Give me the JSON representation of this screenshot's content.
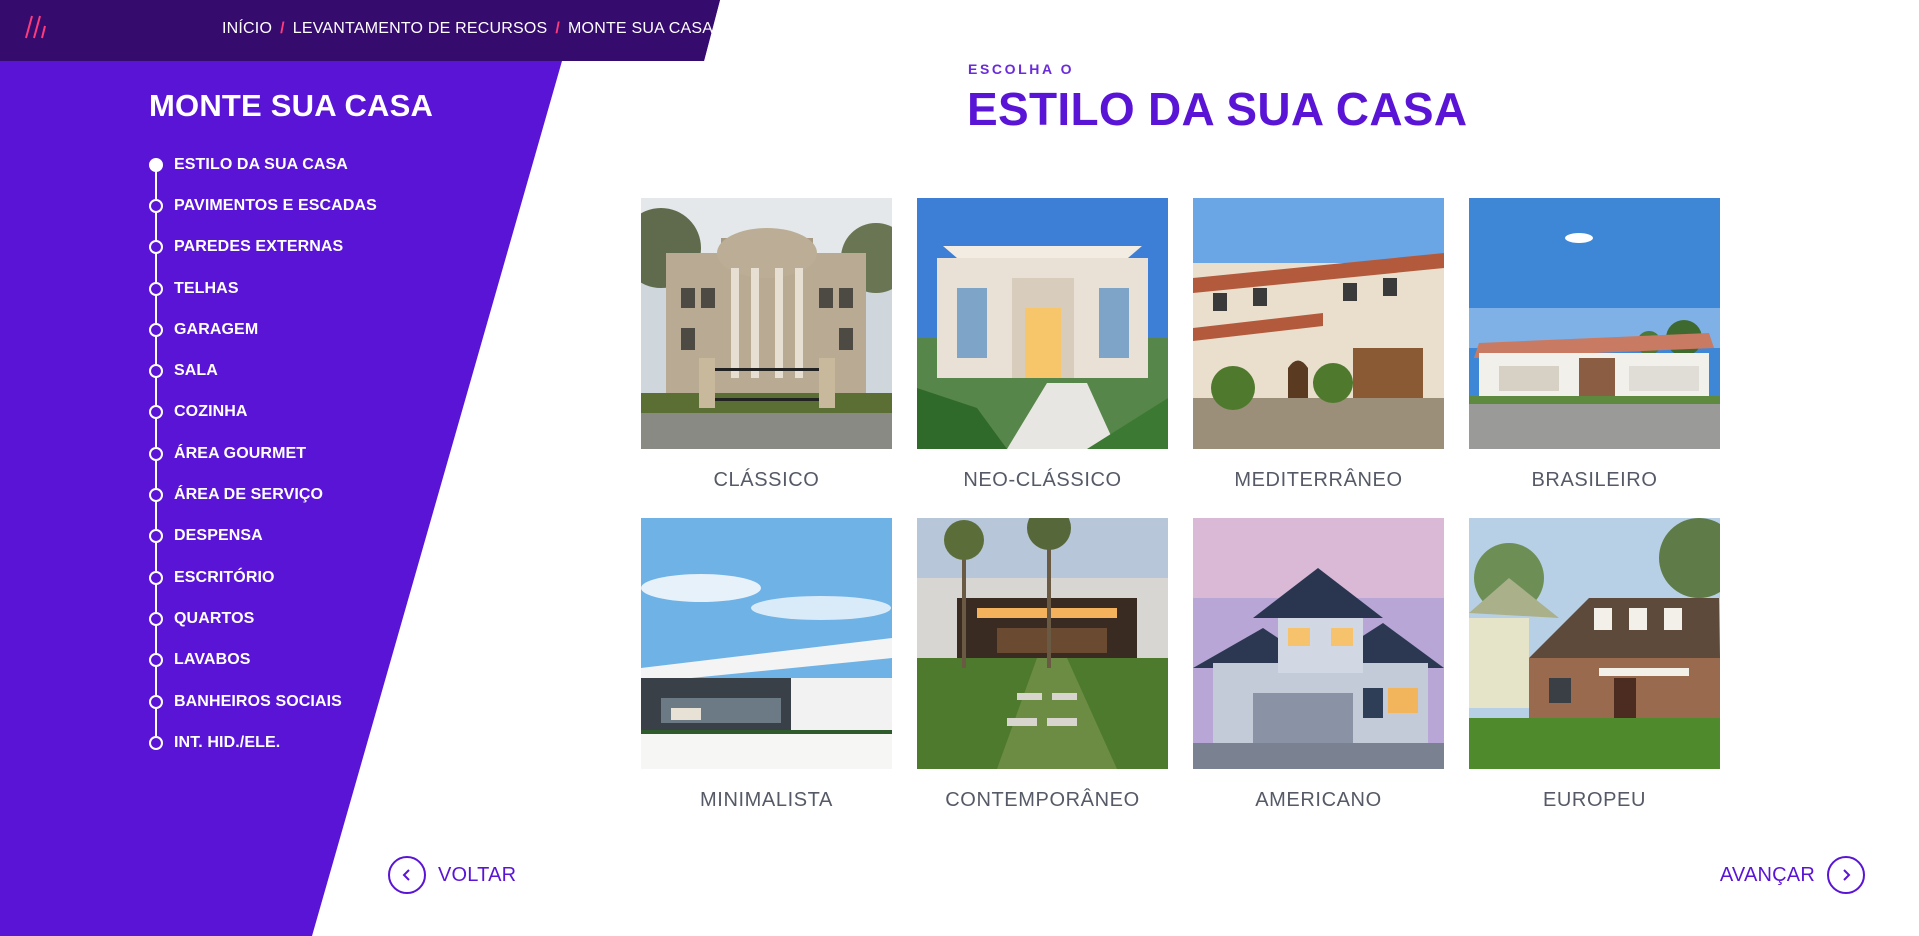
{
  "colors": {
    "accent": "#5a14d6",
    "topbar": "#360b6e",
    "separator": "#ff3b7a",
    "card_label": "#555a66"
  },
  "breadcrumb": [
    {
      "label": "INÍCIO"
    },
    {
      "label": "LEVANTAMENTO DE RECURSOS"
    },
    {
      "label": "MONTE SUA CASA"
    }
  ],
  "sidebar": {
    "title": "MONTE SUA CASA",
    "steps": [
      {
        "label": "ESTILO DA SUA CASA",
        "active": true
      },
      {
        "label": "PAVIMENTOS E ESCADAS"
      },
      {
        "label": "PAREDES EXTERNAS"
      },
      {
        "label": "TELHAS"
      },
      {
        "label": "GARAGEM"
      },
      {
        "label": "SALA"
      },
      {
        "label": "COZINHA"
      },
      {
        "label": "ÁREA GOURMET"
      },
      {
        "label": "ÁREA DE SERVIÇO"
      },
      {
        "label": "DESPENSA"
      },
      {
        "label": "ESCRITÓRIO"
      },
      {
        "label": "QUARTOS"
      },
      {
        "label": "LAVABOS"
      },
      {
        "label": "BANHEIROS SOCIAIS"
      },
      {
        "label": "INT. HID./ELE."
      }
    ]
  },
  "main": {
    "kicker": "ESCOLHA O",
    "title": "ESTILO DA SUA CASA",
    "styles": [
      {
        "label": "CLÁSSICO"
      },
      {
        "label": "NEO-CLÁSSICO"
      },
      {
        "label": "MEDITERRÂNEO"
      },
      {
        "label": "BRASILEIRO"
      },
      {
        "label": "MINIMALISTA"
      },
      {
        "label": "CONTEMPORÂNEO"
      },
      {
        "label": "AMERICANO"
      },
      {
        "label": "EUROPEU"
      }
    ]
  },
  "nav": {
    "back_label": "VOLTAR",
    "next_label": "AVANÇAR"
  }
}
